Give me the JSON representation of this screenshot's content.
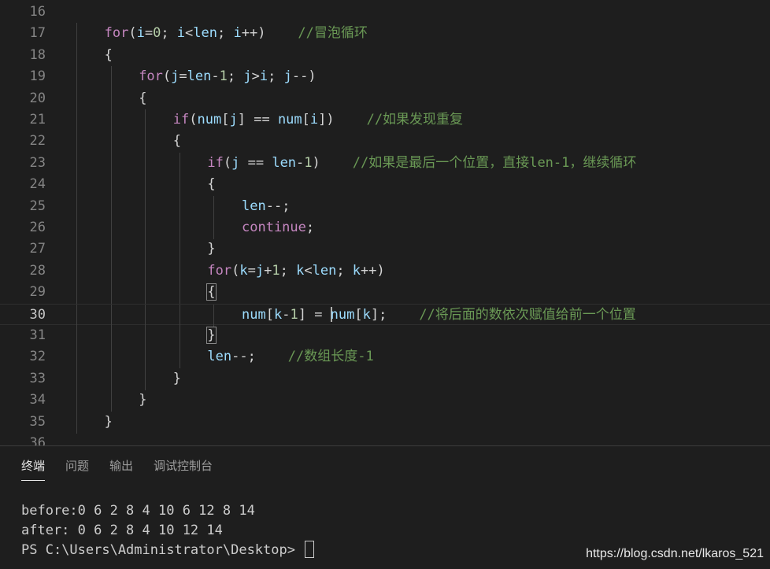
{
  "editor": {
    "lines": [
      {
        "n": "16",
        "indent": 0,
        "tokens": []
      },
      {
        "n": "17",
        "indent": 1,
        "tokens": [
          [
            "kw",
            "for"
          ],
          [
            "op",
            "("
          ],
          [
            "var",
            "i"
          ],
          [
            "op",
            "="
          ],
          [
            "num",
            "0"
          ],
          [
            "op",
            "; "
          ],
          [
            "var",
            "i"
          ],
          [
            "op",
            "<"
          ],
          [
            "var",
            "len"
          ],
          [
            "op",
            "; "
          ],
          [
            "var",
            "i"
          ],
          [
            "op",
            "++)    "
          ],
          [
            "cmt",
            "//冒泡循环"
          ]
        ]
      },
      {
        "n": "18",
        "indent": 1,
        "tokens": [
          [
            "op",
            "{"
          ]
        ]
      },
      {
        "n": "19",
        "indent": 2,
        "tokens": [
          [
            "kw",
            "for"
          ],
          [
            "op",
            "("
          ],
          [
            "var",
            "j"
          ],
          [
            "op",
            "="
          ],
          [
            "var",
            "len"
          ],
          [
            "op",
            "-"
          ],
          [
            "num",
            "1"
          ],
          [
            "op",
            "; "
          ],
          [
            "var",
            "j"
          ],
          [
            "op",
            ">"
          ],
          [
            "var",
            "i"
          ],
          [
            "op",
            "; "
          ],
          [
            "var",
            "j"
          ],
          [
            "op",
            "--)"
          ]
        ]
      },
      {
        "n": "20",
        "indent": 2,
        "tokens": [
          [
            "op",
            "{"
          ]
        ]
      },
      {
        "n": "21",
        "indent": 3,
        "tokens": [
          [
            "kw",
            "if"
          ],
          [
            "op",
            "("
          ],
          [
            "var",
            "num"
          ],
          [
            "op",
            "["
          ],
          [
            "var",
            "j"
          ],
          [
            "op",
            "] == "
          ],
          [
            "var",
            "num"
          ],
          [
            "op",
            "["
          ],
          [
            "var",
            "i"
          ],
          [
            "op",
            "])    "
          ],
          [
            "cmt",
            "//如果发现重复"
          ]
        ]
      },
      {
        "n": "22",
        "indent": 3,
        "tokens": [
          [
            "op",
            "{"
          ]
        ]
      },
      {
        "n": "23",
        "indent": 4,
        "tokens": [
          [
            "kw",
            "if"
          ],
          [
            "op",
            "("
          ],
          [
            "var",
            "j"
          ],
          [
            "op",
            " == "
          ],
          [
            "var",
            "len"
          ],
          [
            "op",
            "-"
          ],
          [
            "num",
            "1"
          ],
          [
            "op",
            ")    "
          ],
          [
            "cmt",
            "//如果是最后一个位置，直接len-1，继续循环"
          ]
        ]
      },
      {
        "n": "24",
        "indent": 4,
        "tokens": [
          [
            "op",
            "{"
          ]
        ]
      },
      {
        "n": "25",
        "indent": 5,
        "tokens": [
          [
            "var",
            "len"
          ],
          [
            "op",
            "--;"
          ]
        ]
      },
      {
        "n": "26",
        "indent": 5,
        "tokens": [
          [
            "kw",
            "continue"
          ],
          [
            "op",
            ";"
          ]
        ]
      },
      {
        "n": "27",
        "indent": 4,
        "tokens": [
          [
            "op",
            "}"
          ]
        ]
      },
      {
        "n": "28",
        "indent": 4,
        "tokens": [
          [
            "kw",
            "for"
          ],
          [
            "op",
            "("
          ],
          [
            "var",
            "k"
          ],
          [
            "op",
            "="
          ],
          [
            "var",
            "j"
          ],
          [
            "op",
            "+"
          ],
          [
            "num",
            "1"
          ],
          [
            "op",
            "; "
          ],
          [
            "var",
            "k"
          ],
          [
            "op",
            "<"
          ],
          [
            "var",
            "len"
          ],
          [
            "op",
            "; "
          ],
          [
            "var",
            "k"
          ],
          [
            "op",
            "++)"
          ]
        ]
      },
      {
        "n": "29",
        "indent": 4,
        "tokens": [
          [
            "bm",
            "{"
          ]
        ]
      },
      {
        "n": "30",
        "indent": 5,
        "current": true,
        "tokens": [
          [
            "var",
            "num"
          ],
          [
            "op",
            "["
          ],
          [
            "var",
            "k"
          ],
          [
            "op",
            "-"
          ],
          [
            "num",
            "1"
          ],
          [
            "op",
            "] = "
          ],
          [
            "cursor",
            ""
          ],
          [
            "var",
            "num"
          ],
          [
            "op",
            "["
          ],
          [
            "var",
            "k"
          ],
          [
            "op",
            "];    "
          ],
          [
            "cmt",
            "//将后面的数依次赋值给前一个位置"
          ]
        ]
      },
      {
        "n": "31",
        "indent": 4,
        "tokens": [
          [
            "bm",
            "}"
          ]
        ]
      },
      {
        "n": "32",
        "indent": 4,
        "tokens": [
          [
            "var",
            "len"
          ],
          [
            "op",
            "--;    "
          ],
          [
            "cmt",
            "//数组长度-1"
          ]
        ]
      },
      {
        "n": "33",
        "indent": 3,
        "tokens": [
          [
            "op",
            "}"
          ]
        ]
      },
      {
        "n": "34",
        "indent": 2,
        "tokens": [
          [
            "op",
            "}"
          ]
        ]
      },
      {
        "n": "35",
        "indent": 1,
        "tokens": [
          [
            "op",
            "}"
          ]
        ]
      },
      {
        "n": "36",
        "indent": 0,
        "tokens": []
      }
    ]
  },
  "panel": {
    "tabs": [
      {
        "label": "终端",
        "active": true
      },
      {
        "label": "问题",
        "active": false
      },
      {
        "label": "输出",
        "active": false
      },
      {
        "label": "调试控制台",
        "active": false
      }
    ],
    "terminal": {
      "line1": "before:0 6 2 8 4 10 6 12 8 14",
      "line2": "after: 0 6 2 8 4 10 12 14",
      "prompt": "PS C:\\Users\\Administrator\\Desktop> "
    }
  },
  "watermark": "https://blog.csdn.net/lkaros_521"
}
